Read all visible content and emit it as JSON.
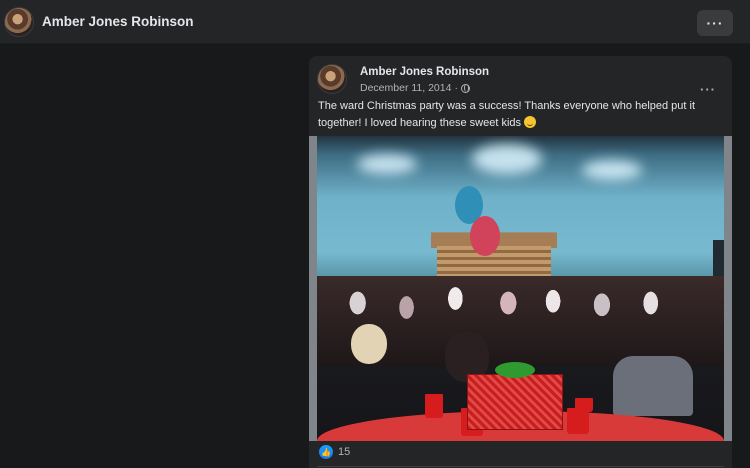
{
  "header": {
    "title": "Amber Jones Robinson",
    "more_label": "···"
  },
  "post": {
    "author": "Amber Jones Robinson",
    "date": "December 11, 2014",
    "separator": "·",
    "more_label": "···",
    "text": "The ward Christmas party was a success! Thanks everyone who helped put it together! I loved hearing these sweet kids",
    "reaction_count": "15"
  },
  "icons": {
    "privacy": "globe-icon",
    "emoji": "smiling-face-icon",
    "reaction": "like-icon"
  },
  "colors": {
    "background": "#18191a",
    "card": "#242526",
    "accent": "#1877f2"
  }
}
